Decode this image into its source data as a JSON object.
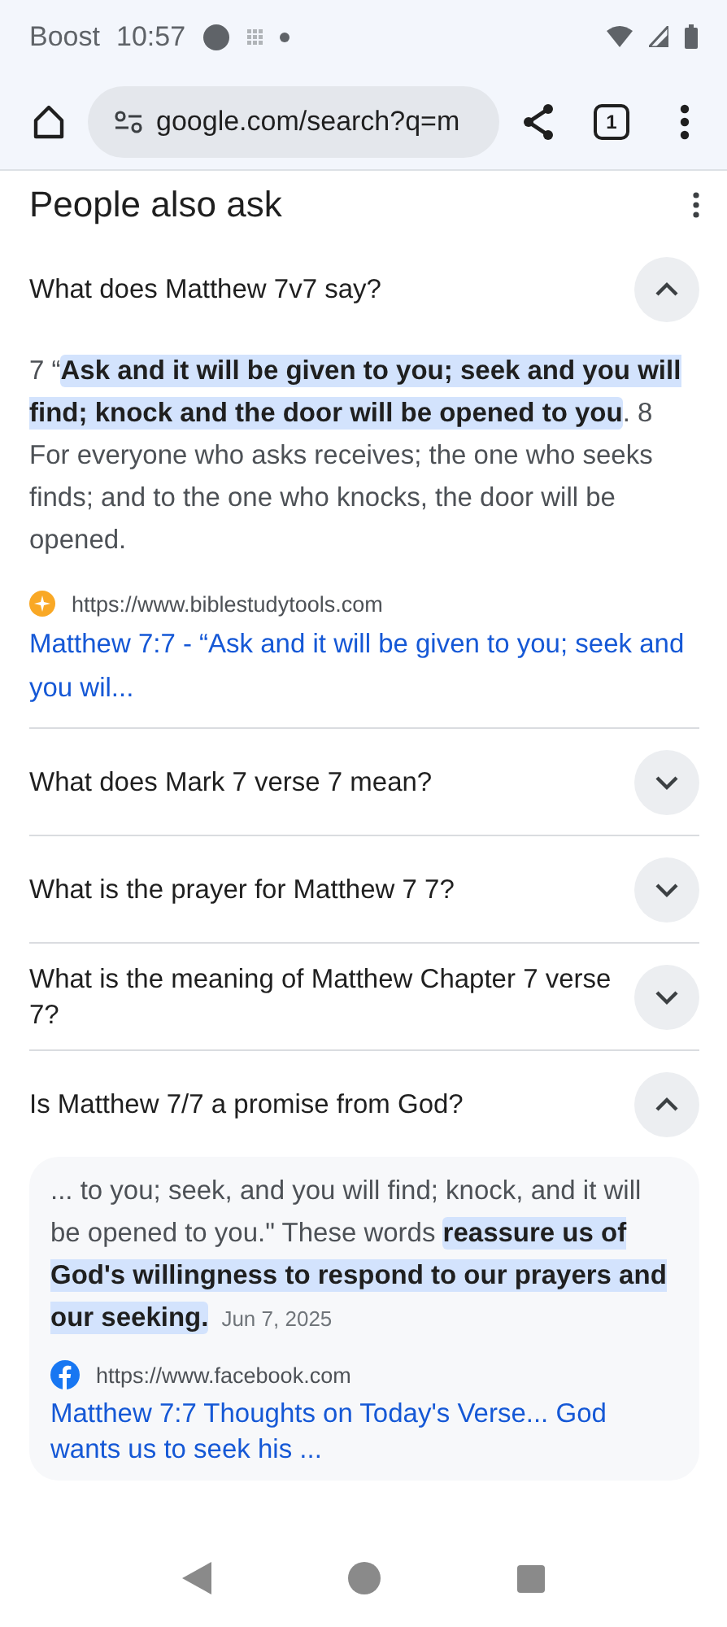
{
  "status_bar": {
    "carrier": "Boost",
    "time": "10:57"
  },
  "browser": {
    "url": "google.com/search?q=m",
    "tab_count": "1"
  },
  "section": {
    "title": "People also ask"
  },
  "questions": [
    {
      "question": "What does Matthew 7v7 say?",
      "expanded": true,
      "answer": {
        "kind": "plain",
        "segments": [
          {
            "text": "7 “",
            "highlighted": false
          },
          {
            "text": "Ask and it will be given to you; seek and you will find; knock and the door will be opened to you",
            "highlighted": true
          },
          {
            "text": ". 8 For everyone who asks receives; the one who seeks finds; and to the one who knocks, the door will be opened.",
            "highlighted": false
          }
        ],
        "source_url": "https://www.biblestudytools.com",
        "link": "Matthew 7:7 - “Ask and it will be given to you; seek and you wil..."
      }
    },
    {
      "question": "What does Mark 7 verse 7 mean?",
      "expanded": false
    },
    {
      "question": "What is the prayer for Matthew 7 7?",
      "expanded": false
    },
    {
      "question": "What is the meaning of Matthew Chapter 7 verse 7?",
      "expanded": false
    },
    {
      "question": "Is Matthew 7/7 a promise from God?",
      "expanded": true,
      "answer": {
        "kind": "card",
        "segments": [
          {
            "text": "... to you; seek, and you will find; knock, and it will be opened to you.\" These words ",
            "highlighted": false
          },
          {
            "text": "reassure us of God's willingness to respond to our prayers and our seeking.",
            "highlighted": true
          }
        ],
        "date": "Jun 7, 2025",
        "source_url": "https://www.facebook.com",
        "link": "Matthew 7:7 Thoughts on Today's Verse... God wants us to seek his ..."
      }
    }
  ]
}
